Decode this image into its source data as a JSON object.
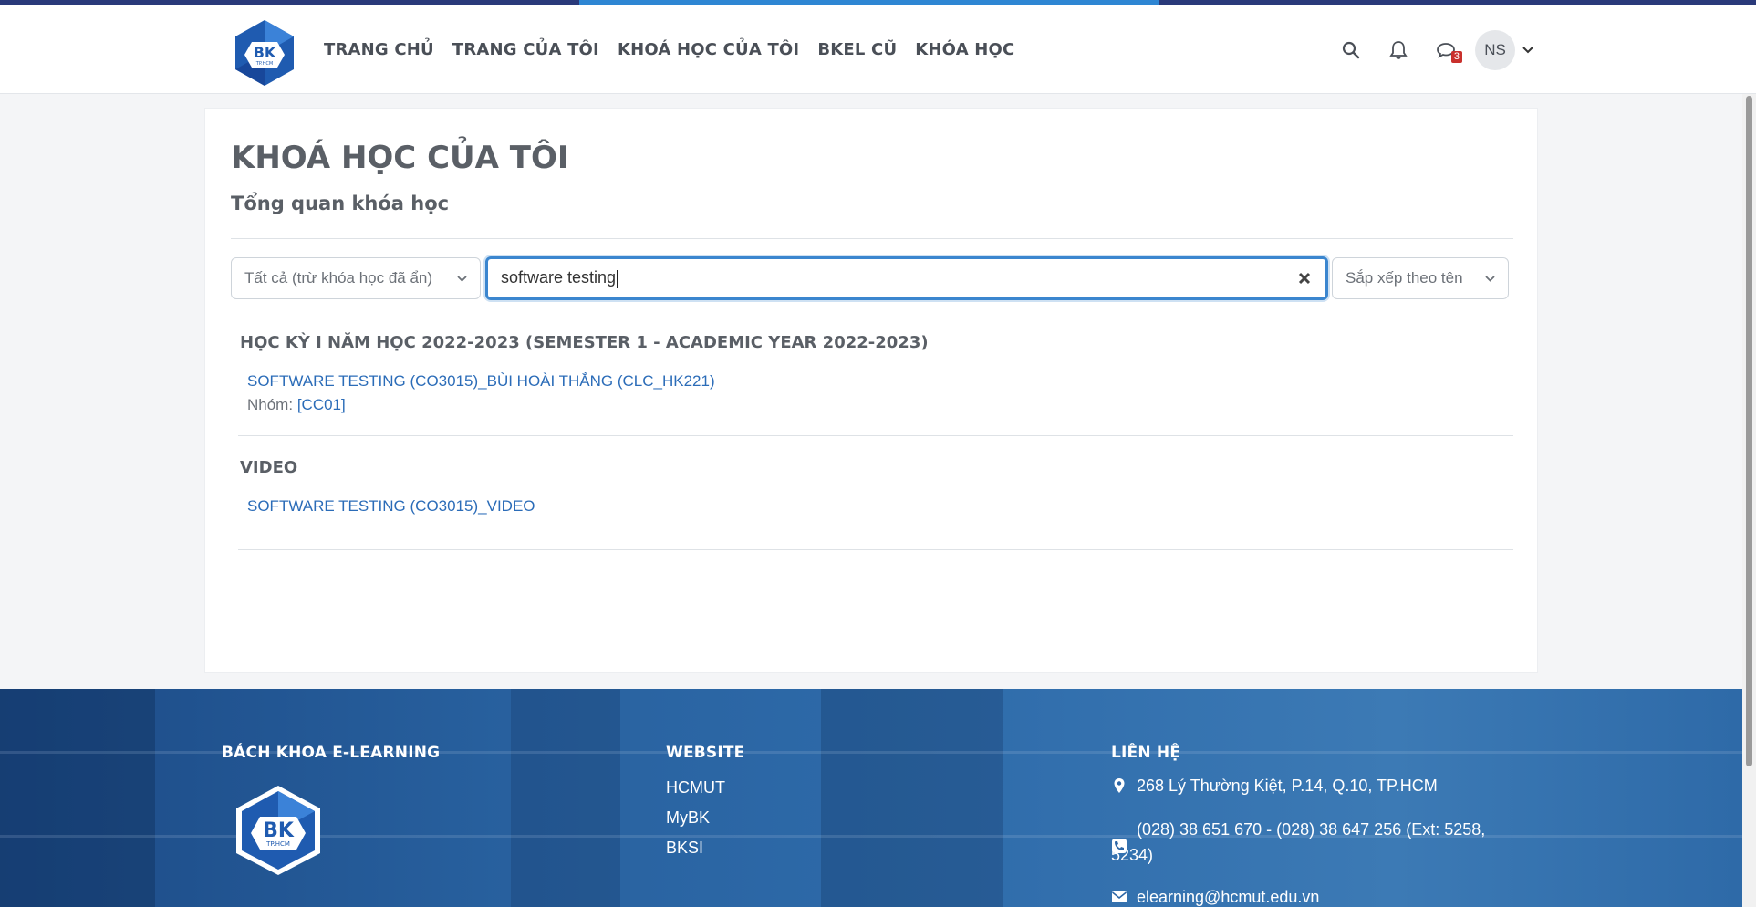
{
  "nav": {
    "logo_text": "BK",
    "logo_sub": "TP.HCM",
    "links": [
      "TRANG CHỦ",
      "TRANG CỦA TÔI",
      "KHOÁ HỌC CỦA TÔI",
      "BKEL CŨ",
      "KHÓA HỌC"
    ],
    "icons": [
      "search-icon",
      "bell-icon",
      "chat-icon"
    ],
    "message_badge": "3",
    "avatar_initials": "NS"
  },
  "page": {
    "title": "KHOÁ HỌC CỦA TÔI",
    "subtitle": "Tổng quan khóa học"
  },
  "filters": {
    "grouping": "Tất cả (trừ khóa học đã ẩn)",
    "search_value": "software testing",
    "sort": "Sắp xếp theo tên"
  },
  "groups": [
    {
      "title": "HỌC KỲ I NĂM HỌC 2022-2023 (SEMESTER 1 - ACADEMIC YEAR 2022-2023)",
      "courses": [
        {
          "name": "SOFTWARE TESTING (CO3015)_BÙI HOÀI THẮNG (CLC_HK221)",
          "group_label": "Nhóm:",
          "group_value": "[CC01]"
        }
      ]
    },
    {
      "title": "VIDEO",
      "courses": [
        {
          "name": "SOFTWARE TESTING (CO3015)_VIDEO"
        }
      ]
    }
  ],
  "footer": {
    "brand_heading": "BÁCH KHOA E-LEARNING",
    "website_heading": "WEBSITE",
    "website_links": [
      "HCMUT",
      "MyBK",
      "BKSI"
    ],
    "contact_heading": "LIÊN HỆ",
    "address": "268 Lý Thường Kiệt, P.14, Q.10, TP.HCM",
    "phone": "(028) 38 651 670 - (028) 38 647 256 (Ext: 5258, 5234)",
    "email": "elearning@hcmut.edu.vn"
  },
  "colors": {
    "accent": "#2e86d3",
    "link": "#2b6cb8",
    "footer": "#28619f",
    "badge": "#c9302c"
  }
}
